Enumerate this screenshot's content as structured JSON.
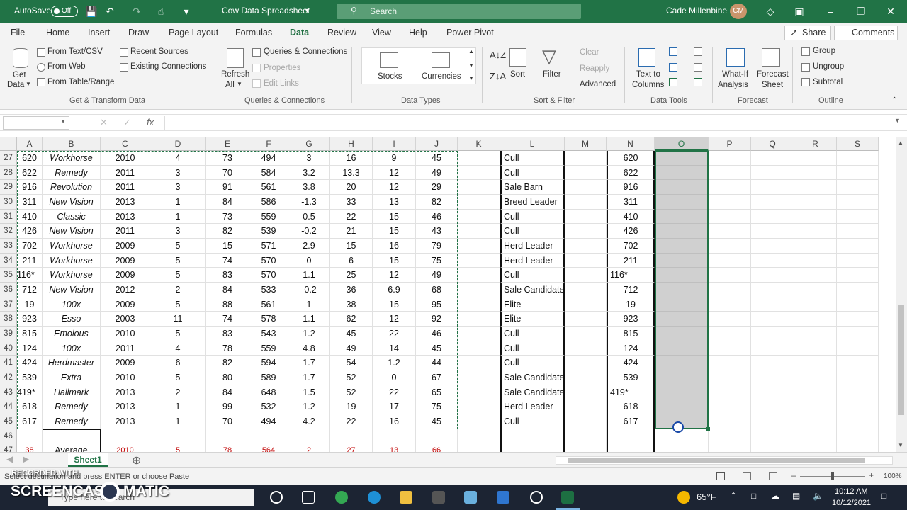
{
  "titlebar": {
    "autosave_label": "AutoSave",
    "autosave_state": "Off",
    "doc_title": "Cow Data Spreadsheet",
    "search_placeholder": "Search",
    "user_name": "Cade Millenbine",
    "user_initials": "CM"
  },
  "menu": {
    "items": [
      "File",
      "Home",
      "Insert",
      "Draw",
      "Page Layout",
      "Formulas",
      "Data",
      "Review",
      "View",
      "Help",
      "Power Pivot"
    ],
    "active": "Data",
    "share": "Share",
    "comments": "Comments"
  },
  "ribbon": {
    "get_data": "Get",
    "get_data2": "Data",
    "from_text_csv": "From Text/CSV",
    "from_web": "From Web",
    "from_table_range": "From Table/Range",
    "recent_sources": "Recent Sources",
    "existing_connections": "Existing Connections",
    "group_get_transform": "Get & Transform Data",
    "refresh": "Refresh",
    "refresh2": "All",
    "queries_connections": "Queries & Connections",
    "properties": "Properties",
    "edit_links": "Edit Links",
    "group_queries": "Queries & Connections",
    "stocks": "Stocks",
    "currencies": "Currencies",
    "group_data_types": "Data Types",
    "sort": "Sort",
    "filter": "Filter",
    "clear": "Clear",
    "reapply": "Reapply",
    "advanced": "Advanced",
    "group_sort_filter": "Sort & Filter",
    "text_to": "Text to",
    "columns": "Columns",
    "group_data_tools": "Data Tools",
    "what_if": "What-If",
    "analysis": "Analysis",
    "forecast": "Forecast",
    "sheet": "Sheet",
    "group_forecast": "Forecast",
    "group": "Group",
    "ungroup": "Ungroup",
    "subtotal": "Subtotal",
    "group_outline": "Outline"
  },
  "formula_bar": {
    "fx": "fx",
    "name_box": "",
    "formula": ""
  },
  "grid": {
    "columns": [
      "A",
      "B",
      "C",
      "D",
      "E",
      "F",
      "G",
      "H",
      "I",
      "J",
      "K",
      "L",
      "M",
      "N",
      "O",
      "P",
      "Q",
      "R",
      "S"
    ],
    "selected_column": "O",
    "rows": [
      {
        "r": "27",
        "A": "620",
        "B": "Workhorse",
        "C": "2010",
        "D": "4",
        "E": "73",
        "F": "494",
        "G": "3",
        "H": "16",
        "I": "9",
        "J": "45",
        "L": "Cull",
        "N": "620"
      },
      {
        "r": "28",
        "A": "622",
        "B": "Remedy",
        "C": "2011",
        "D": "3",
        "E": "70",
        "F": "584",
        "G": "3.2",
        "H": "13.3",
        "I": "12",
        "J": "49",
        "L": "Cull",
        "N": "622"
      },
      {
        "r": "29",
        "A": "916",
        "B": "Revolution",
        "C": "2011",
        "D": "3",
        "E": "91",
        "F": "561",
        "G": "3.8",
        "H": "20",
        "I": "12",
        "J": "29",
        "L": "Sale Barn",
        "N": "916"
      },
      {
        "r": "30",
        "A": "311",
        "B": "New Vision",
        "C": "2013",
        "D": "1",
        "E": "84",
        "F": "586",
        "G": "-1.3",
        "H": "33",
        "I": "13",
        "J": "82",
        "L": "Breed Leader",
        "N": "311"
      },
      {
        "r": "31",
        "A": "410",
        "B": "Classic",
        "C": "2013",
        "D": "1",
        "E": "73",
        "F": "559",
        "G": "0.5",
        "H": "22",
        "I": "15",
        "J": "46",
        "L": "Cull",
        "N": "410"
      },
      {
        "r": "32",
        "A": "426",
        "B": "New Vision",
        "C": "2011",
        "D": "3",
        "E": "82",
        "F": "539",
        "G": "-0.2",
        "H": "21",
        "I": "15",
        "J": "43",
        "L": "Cull",
        "N": "426"
      },
      {
        "r": "33",
        "A": "702",
        "B": "Workhorse",
        "C": "2009",
        "D": "5",
        "E": "15",
        "F": "571",
        "G": "2.9",
        "H": "15",
        "I": "16",
        "J": "79",
        "L": "Herd Leader",
        "N": "702"
      },
      {
        "r": "34",
        "A": "211",
        "B": "Workhorse",
        "C": "2009",
        "D": "5",
        "E": "74",
        "F": "570",
        "G": "0",
        "H": "6",
        "I": "15",
        "J": "75",
        "L": "Herd Leader",
        "N": "211"
      },
      {
        "r": "35",
        "A": "116*",
        "B": "Workhorse",
        "C": "2009",
        "D": "5",
        "E": "83",
        "F": "570",
        "G": "1.1",
        "H": "25",
        "I": "12",
        "J": "49",
        "L": "Cull",
        "N": "116*"
      },
      {
        "r": "36",
        "A": "712",
        "B": "New Vision",
        "C": "2012",
        "D": "2",
        "E": "84",
        "F": "533",
        "G": "-0.2",
        "H": "36",
        "I": "6.9",
        "J": "68",
        "L": "Sale Candidate",
        "N": "712"
      },
      {
        "r": "37",
        "A": "19",
        "B": "100x",
        "C": "2009",
        "D": "5",
        "E": "88",
        "F": "561",
        "G": "1",
        "H": "38",
        "I": "15",
        "J": "95",
        "L": "Elite",
        "N": "19"
      },
      {
        "r": "38",
        "A": "923",
        "B": "Esso",
        "C": "2003",
        "D": "11",
        "E": "74",
        "F": "578",
        "G": "1.1",
        "H": "62",
        "I": "12",
        "J": "92",
        "L": "Elite",
        "N": "923"
      },
      {
        "r": "39",
        "A": "815",
        "B": "Emolous",
        "C": "2010",
        "D": "5",
        "E": "83",
        "F": "543",
        "G": "1.2",
        "H": "45",
        "I": "22",
        "J": "46",
        "L": "Cull",
        "N": "815"
      },
      {
        "r": "40",
        "A": "124",
        "B": "100x",
        "C": "2011",
        "D": "4",
        "E": "78",
        "F": "559",
        "G": "4.8",
        "H": "49",
        "I": "14",
        "J": "45",
        "L": "Cull",
        "N": "124"
      },
      {
        "r": "41",
        "A": "424",
        "B": "Herdmaster",
        "C": "2009",
        "D": "6",
        "E": "82",
        "F": "594",
        "G": "1.7",
        "H": "54",
        "I": "1.2",
        "J": "44",
        "L": "Cull",
        "N": "424"
      },
      {
        "r": "42",
        "A": "539",
        "B": "Extra",
        "C": "2010",
        "D": "5",
        "E": "80",
        "F": "589",
        "G": "1.7",
        "H": "52",
        "I": "0",
        "J": "67",
        "L": "Sale Candidate",
        "N": "539"
      },
      {
        "r": "43",
        "A": "419*",
        "B": "Hallmark",
        "C": "2013",
        "D": "2",
        "E": "84",
        "F": "648",
        "G": "1.5",
        "H": "52",
        "I": "22",
        "J": "65",
        "L": "Sale Candidate",
        "N": "419*"
      },
      {
        "r": "44",
        "A": "618",
        "B": "Remedy",
        "C": "2013",
        "D": "1",
        "E": "99",
        "F": "532",
        "G": "1.2",
        "H": "19",
        "I": "17",
        "J": "75",
        "L": "Herd Leader",
        "N": "618"
      },
      {
        "r": "45",
        "A": "617",
        "B": "Remedy",
        "C": "2013",
        "D": "1",
        "E": "70",
        "F": "494",
        "G": "4.2",
        "H": "22",
        "I": "16",
        "J": "45",
        "L": "Cull",
        "N": "617"
      },
      {
        "r": "46"
      },
      {
        "r": "47",
        "A": "38",
        "B": "Average",
        "C": "2010",
        "D": "5",
        "E": "78",
        "F": "564",
        "G": "2",
        "H": "27",
        "I": "13",
        "J": "66"
      }
    ]
  },
  "sheets": {
    "tab": "Sheet1"
  },
  "status": {
    "message": "Select destination and press ENTER or choose Paste",
    "zoom": "100%"
  },
  "taskbar": {
    "search_placeholder": "Type here to search",
    "weather": "65°F",
    "time": "10:12 AM",
    "date": "10/12/2021"
  },
  "watermark": {
    "line1": "RECORDED WITH",
    "line2": "SCREENCAST",
    "line3": "MATIC"
  }
}
